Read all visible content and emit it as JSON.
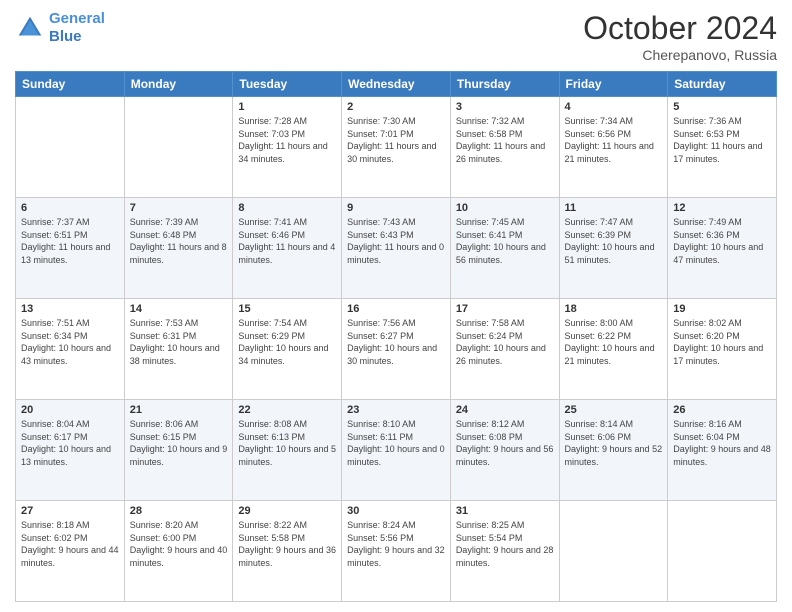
{
  "header": {
    "logo_line1": "General",
    "logo_line2": "Blue",
    "month": "October 2024",
    "location": "Cherepanovo, Russia"
  },
  "weekdays": [
    "Sunday",
    "Monday",
    "Tuesday",
    "Wednesday",
    "Thursday",
    "Friday",
    "Saturday"
  ],
  "weeks": [
    [
      {
        "day": "",
        "info": ""
      },
      {
        "day": "",
        "info": ""
      },
      {
        "day": "1",
        "info": "Sunrise: 7:28 AM\nSunset: 7:03 PM\nDaylight: 11 hours and 34 minutes."
      },
      {
        "day": "2",
        "info": "Sunrise: 7:30 AM\nSunset: 7:01 PM\nDaylight: 11 hours and 30 minutes."
      },
      {
        "day": "3",
        "info": "Sunrise: 7:32 AM\nSunset: 6:58 PM\nDaylight: 11 hours and 26 minutes."
      },
      {
        "day": "4",
        "info": "Sunrise: 7:34 AM\nSunset: 6:56 PM\nDaylight: 11 hours and 21 minutes."
      },
      {
        "day": "5",
        "info": "Sunrise: 7:36 AM\nSunset: 6:53 PM\nDaylight: 11 hours and 17 minutes."
      }
    ],
    [
      {
        "day": "6",
        "info": "Sunrise: 7:37 AM\nSunset: 6:51 PM\nDaylight: 11 hours and 13 minutes."
      },
      {
        "day": "7",
        "info": "Sunrise: 7:39 AM\nSunset: 6:48 PM\nDaylight: 11 hours and 8 minutes."
      },
      {
        "day": "8",
        "info": "Sunrise: 7:41 AM\nSunset: 6:46 PM\nDaylight: 11 hours and 4 minutes."
      },
      {
        "day": "9",
        "info": "Sunrise: 7:43 AM\nSunset: 6:43 PM\nDaylight: 11 hours and 0 minutes."
      },
      {
        "day": "10",
        "info": "Sunrise: 7:45 AM\nSunset: 6:41 PM\nDaylight: 10 hours and 56 minutes."
      },
      {
        "day": "11",
        "info": "Sunrise: 7:47 AM\nSunset: 6:39 PM\nDaylight: 10 hours and 51 minutes."
      },
      {
        "day": "12",
        "info": "Sunrise: 7:49 AM\nSunset: 6:36 PM\nDaylight: 10 hours and 47 minutes."
      }
    ],
    [
      {
        "day": "13",
        "info": "Sunrise: 7:51 AM\nSunset: 6:34 PM\nDaylight: 10 hours and 43 minutes."
      },
      {
        "day": "14",
        "info": "Sunrise: 7:53 AM\nSunset: 6:31 PM\nDaylight: 10 hours and 38 minutes."
      },
      {
        "day": "15",
        "info": "Sunrise: 7:54 AM\nSunset: 6:29 PM\nDaylight: 10 hours and 34 minutes."
      },
      {
        "day": "16",
        "info": "Sunrise: 7:56 AM\nSunset: 6:27 PM\nDaylight: 10 hours and 30 minutes."
      },
      {
        "day": "17",
        "info": "Sunrise: 7:58 AM\nSunset: 6:24 PM\nDaylight: 10 hours and 26 minutes."
      },
      {
        "day": "18",
        "info": "Sunrise: 8:00 AM\nSunset: 6:22 PM\nDaylight: 10 hours and 21 minutes."
      },
      {
        "day": "19",
        "info": "Sunrise: 8:02 AM\nSunset: 6:20 PM\nDaylight: 10 hours and 17 minutes."
      }
    ],
    [
      {
        "day": "20",
        "info": "Sunrise: 8:04 AM\nSunset: 6:17 PM\nDaylight: 10 hours and 13 minutes."
      },
      {
        "day": "21",
        "info": "Sunrise: 8:06 AM\nSunset: 6:15 PM\nDaylight: 10 hours and 9 minutes."
      },
      {
        "day": "22",
        "info": "Sunrise: 8:08 AM\nSunset: 6:13 PM\nDaylight: 10 hours and 5 minutes."
      },
      {
        "day": "23",
        "info": "Sunrise: 8:10 AM\nSunset: 6:11 PM\nDaylight: 10 hours and 0 minutes."
      },
      {
        "day": "24",
        "info": "Sunrise: 8:12 AM\nSunset: 6:08 PM\nDaylight: 9 hours and 56 minutes."
      },
      {
        "day": "25",
        "info": "Sunrise: 8:14 AM\nSunset: 6:06 PM\nDaylight: 9 hours and 52 minutes."
      },
      {
        "day": "26",
        "info": "Sunrise: 8:16 AM\nSunset: 6:04 PM\nDaylight: 9 hours and 48 minutes."
      }
    ],
    [
      {
        "day": "27",
        "info": "Sunrise: 8:18 AM\nSunset: 6:02 PM\nDaylight: 9 hours and 44 minutes."
      },
      {
        "day": "28",
        "info": "Sunrise: 8:20 AM\nSunset: 6:00 PM\nDaylight: 9 hours and 40 minutes."
      },
      {
        "day": "29",
        "info": "Sunrise: 8:22 AM\nSunset: 5:58 PM\nDaylight: 9 hours and 36 minutes."
      },
      {
        "day": "30",
        "info": "Sunrise: 8:24 AM\nSunset: 5:56 PM\nDaylight: 9 hours and 32 minutes."
      },
      {
        "day": "31",
        "info": "Sunrise: 8:25 AM\nSunset: 5:54 PM\nDaylight: 9 hours and 28 minutes."
      },
      {
        "day": "",
        "info": ""
      },
      {
        "day": "",
        "info": ""
      }
    ]
  ]
}
